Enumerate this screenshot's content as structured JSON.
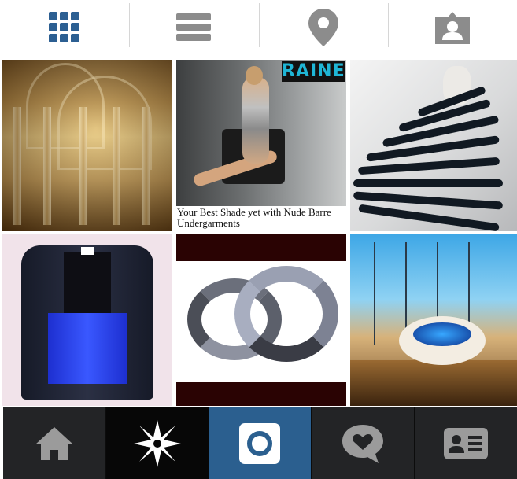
{
  "colors": {
    "top_icon_blue": "#2c5f92",
    "top_icon_gray": "#8c8c8c",
    "nav_bg": "#232426",
    "nav_active_bg": "#2b5f8f",
    "nav_icon": "#9b9b9b"
  },
  "top_tabs": [
    {
      "icon": "grid-view-icon",
      "active": true
    },
    {
      "icon": "list-view-icon",
      "active": false
    },
    {
      "icon": "location-pin-icon",
      "active": false
    },
    {
      "icon": "tagged-photos-icon",
      "active": false
    }
  ],
  "posts": [
    {
      "id": "palace-interior-photo"
    },
    {
      "id": "fashion-ad-photo",
      "brand": "RAINE",
      "caption": "Your Best Shade yet with Nude Barre Undergarments"
    },
    {
      "id": "sculptural-garment-photo"
    },
    {
      "id": "blazer-photo"
    },
    {
      "id": "bracelets-photo"
    },
    {
      "id": "futuristic-room-photo"
    }
  ],
  "bottom_nav": [
    {
      "icon": "home-icon",
      "active": false
    },
    {
      "icon": "explore-star-icon",
      "active": false
    },
    {
      "icon": "camera-icon",
      "active": true
    },
    {
      "icon": "activity-heart-icon",
      "active": false
    },
    {
      "icon": "profile-card-icon",
      "active": false
    }
  ]
}
